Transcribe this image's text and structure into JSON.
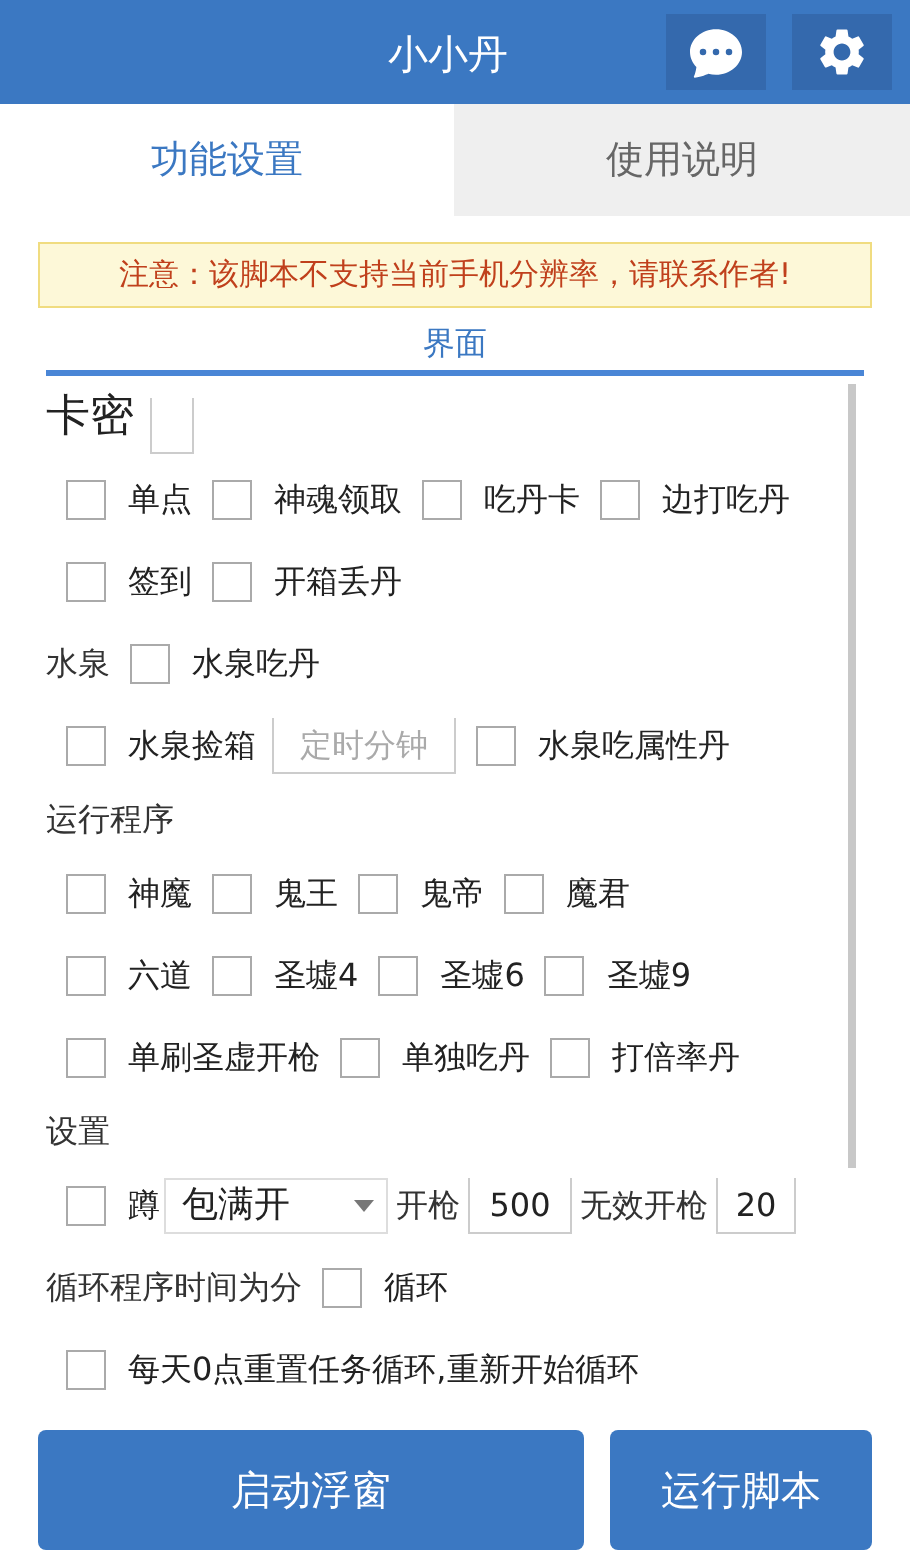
{
  "header": {
    "title": "小小丹"
  },
  "tabs": [
    {
      "label": "功能设置",
      "selected": true
    },
    {
      "label": "使用说明",
      "selected": false
    }
  ],
  "notice": "注意：该脚本不支持当前手机分辨率，请联系作者!",
  "panel_title": "界面",
  "rows": [
    {
      "kind": "heading",
      "items": [
        {
          "kind": "heading",
          "text": "卡密"
        },
        {
          "kind": "input"
        }
      ]
    },
    {
      "kind": "options",
      "items": [
        {
          "kind": "checkbox",
          "label": "单点",
          "checked": false
        },
        {
          "kind": "checkbox",
          "label": "神魂领取",
          "checked": false
        },
        {
          "kind": "checkbox",
          "label": "吃丹卡",
          "checked": false
        },
        {
          "kind": "checkbox",
          "label": "边打吃丹",
          "checked": false
        }
      ]
    },
    {
      "kind": "options",
      "items": [
        {
          "kind": "checkbox",
          "label": "签到",
          "checked": false
        },
        {
          "kind": "checkbox",
          "label": "开箱丢丹",
          "checked": false
        }
      ]
    },
    {
      "kind": "options",
      "items": [
        {
          "kind": "label",
          "text": "水泉"
        },
        {
          "kind": "checkbox",
          "label": "水泉吃丹",
          "checked": false
        }
      ]
    },
    {
      "kind": "options",
      "items": [
        {
          "kind": "checkbox",
          "label": "水泉捡箱",
          "checked": false
        },
        {
          "kind": "input",
          "placeholder": "定时分钟"
        },
        {
          "kind": "checkbox",
          "label": "水泉吃属性丹",
          "checked": false
        }
      ]
    },
    {
      "kind": "section",
      "items": [
        {
          "kind": "label",
          "text": "运行程序"
        }
      ]
    },
    {
      "kind": "options",
      "items": [
        {
          "kind": "checkbox",
          "label": "神魔",
          "checked": false
        },
        {
          "kind": "checkbox",
          "label": "鬼王",
          "checked": false
        },
        {
          "kind": "checkbox",
          "label": "鬼帝",
          "checked": false
        },
        {
          "kind": "checkbox",
          "label": "魔君",
          "checked": false
        }
      ]
    },
    {
      "kind": "options",
      "items": [
        {
          "kind": "checkbox",
          "label": "六道",
          "checked": false
        },
        {
          "kind": "checkbox",
          "label": "圣墟4",
          "checked": false
        },
        {
          "kind": "checkbox",
          "label": "圣墟6",
          "checked": false
        },
        {
          "kind": "checkbox",
          "label": "圣墟9",
          "checked": false
        }
      ]
    },
    {
      "kind": "options",
      "items": [
        {
          "kind": "checkbox",
          "label": "单刷圣虚开枪",
          "checked": false
        },
        {
          "kind": "checkbox",
          "label": "单独吃丹",
          "checked": false
        },
        {
          "kind": "checkbox",
          "label": "打倍率丹",
          "checked": false
        }
      ]
    },
    {
      "kind": "section",
      "items": [
        {
          "kind": "label",
          "text": "设置"
        }
      ]
    },
    {
      "kind": "options",
      "items": [
        {
          "kind": "checkbox",
          "label": "蹲",
          "checked": false
        },
        {
          "kind": "select",
          "value": "包满开"
        },
        {
          "kind": "label",
          "text": "开枪"
        },
        {
          "kind": "input",
          "value": "500"
        },
        {
          "kind": "label",
          "text": "无效开枪"
        },
        {
          "kind": "input",
          "value": "20"
        }
      ]
    },
    {
      "kind": "options",
      "items": [
        {
          "kind": "label",
          "text": "循环程序时间为分"
        },
        {
          "kind": "checkbox",
          "label": "循环",
          "checked": false
        }
      ]
    },
    {
      "kind": "options",
      "items": [
        {
          "kind": "checkbox",
          "label": "每天0点重置任务循环,重新开始循环",
          "checked": false
        }
      ]
    }
  ],
  "buttons": [
    {
      "label": "启动浮窗"
    },
    {
      "label": "运行脚本"
    }
  ]
}
